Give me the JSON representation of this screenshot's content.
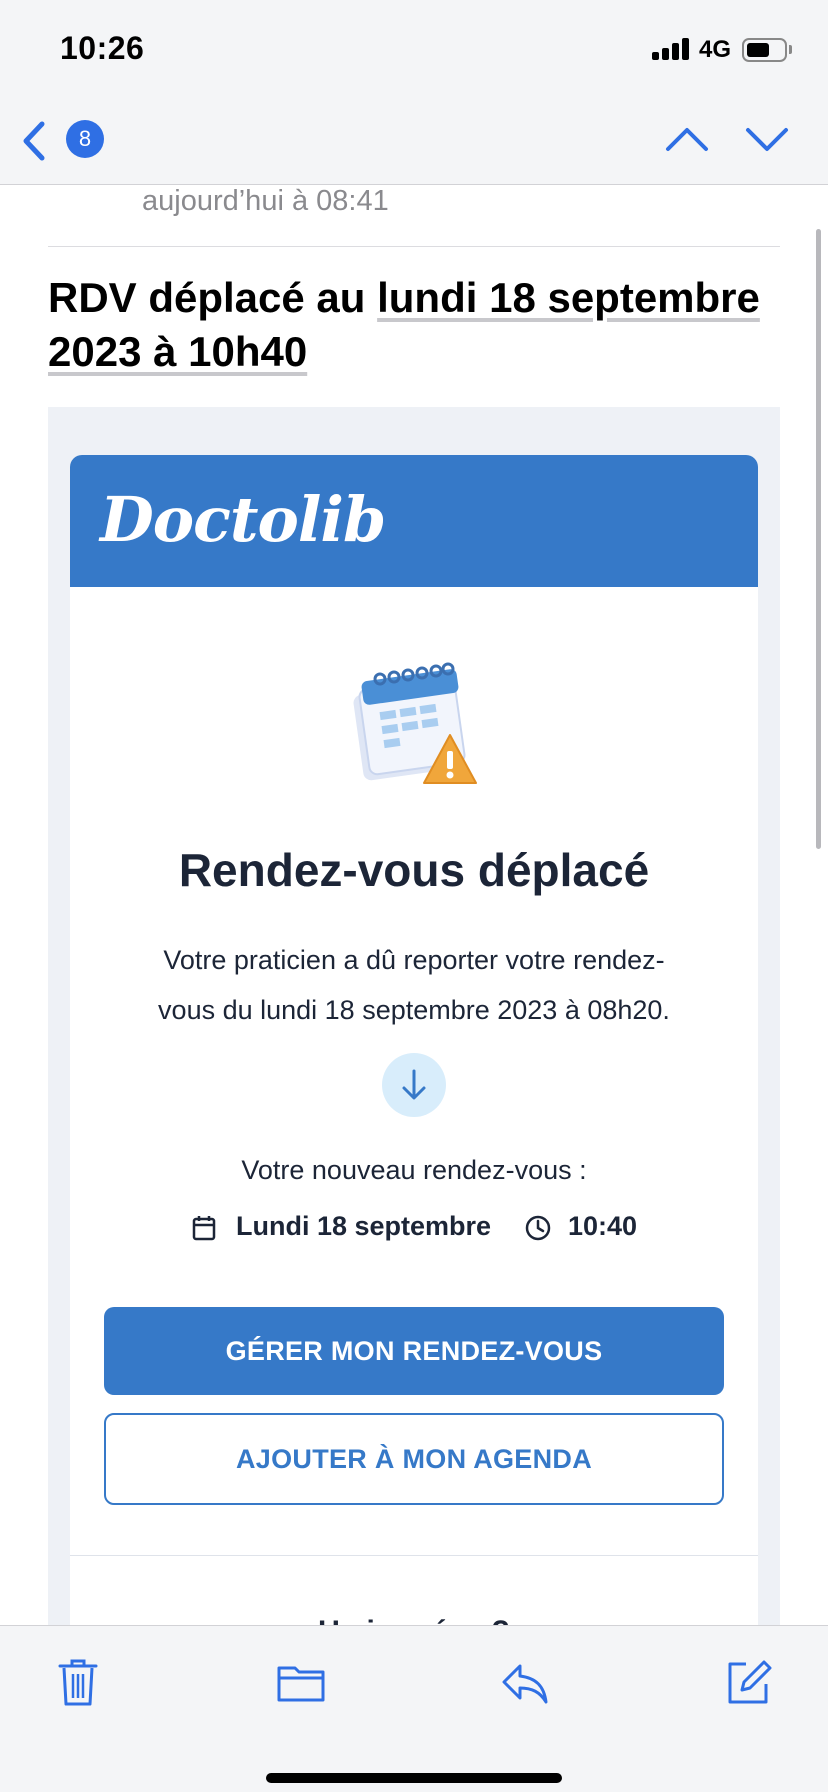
{
  "status_bar": {
    "time": "10:26",
    "network": "4G",
    "battery_level": 0.5
  },
  "nav": {
    "back_badge": "8"
  },
  "email": {
    "date": "aujourd’hui à 08:41",
    "subject_prefix": "RDV déplacé au ",
    "subject_date": "lundi 18 septembre 2023 à 10h40"
  },
  "card": {
    "logo": "Doctolib",
    "title": "Rendez-vous déplacé",
    "text": "Votre praticien a dû reporter votre rendez-vous du lundi 18 septembre 2023 à 08h20.",
    "new_label": "Votre nouveau rendez-vous :",
    "new_date": "Lundi 18 septembre",
    "new_time": "10:40",
    "manage_button": "GÉRER MON RENDEZ-VOUS",
    "add_button": "AJOUTER À MON AGENDA",
    "unforeseen": "Un imprévu ?"
  },
  "colors": {
    "brand_blue": "#3679c8",
    "ios_blue": "#2f6fe4",
    "text_dark": "#1c2537"
  },
  "icons": [
    "back-chevron-icon",
    "chevron-up-icon",
    "chevron-down-icon",
    "calendar-warning-icon",
    "arrow-down-icon",
    "calendar-icon",
    "clock-icon",
    "trash-icon",
    "folder-icon",
    "reply-icon",
    "compose-icon"
  ]
}
